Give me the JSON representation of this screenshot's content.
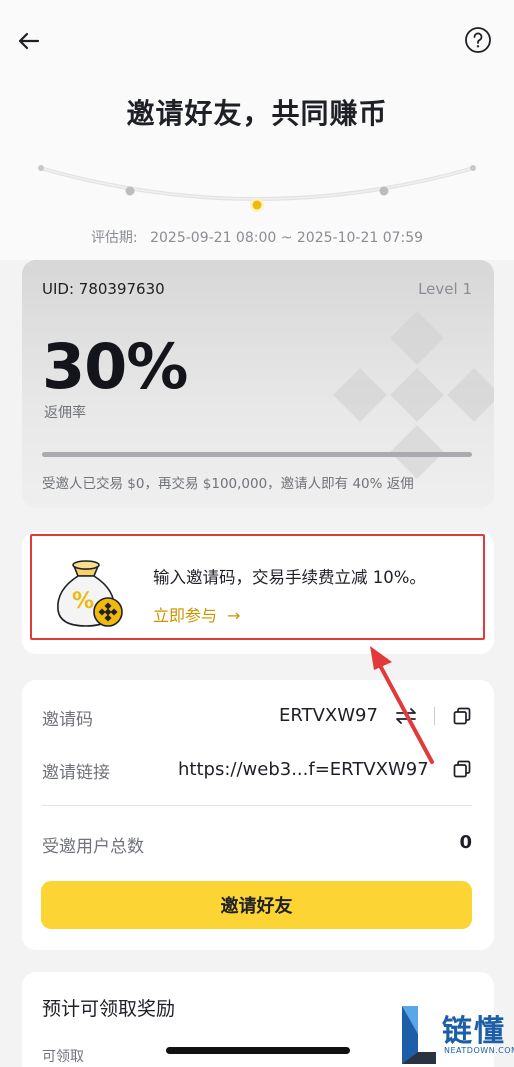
{
  "header": {
    "title": "邀请好友，共同赚币",
    "period_label": "评估期:",
    "period_range": "2025-09-21 08:00 ~ 2025-10-21 07:59"
  },
  "rebate_card": {
    "uid": "UID: 780397630",
    "level": "Level 1",
    "rate": "30%",
    "rate_label": "返佣率",
    "progress_fraction": 0,
    "progress_text": "受邀人已交易 $0，再交易 $100,000，邀请人即有 40% 返佣"
  },
  "promo": {
    "text": "输入邀请码，交易手续费立减 10%。",
    "join_label": "立即参与",
    "join_arrow": "→"
  },
  "invite": {
    "code_label": "邀请码",
    "code_value": "ERTVXW97",
    "link_label": "邀请链接",
    "link_value": "https://web3...f=ERTVXW97",
    "count_label": "受邀用户总数",
    "count_value": "0",
    "button_label": "邀请好友"
  },
  "rewards": {
    "title": "预计可领取奖励",
    "claim_label": "可领取"
  },
  "watermark": {
    "name": "链懂",
    "site": "NEATDOWN.COM"
  },
  "colors": {
    "accent": "#FCD535",
    "link": "#C99400",
    "highlight": "#E23A3A"
  },
  "icons": {
    "back": "arrow-left-icon",
    "help": "question-circle-icon",
    "copy": "copy-icon",
    "swap": "swap-icon",
    "money_bag": "money-bag-icon"
  }
}
